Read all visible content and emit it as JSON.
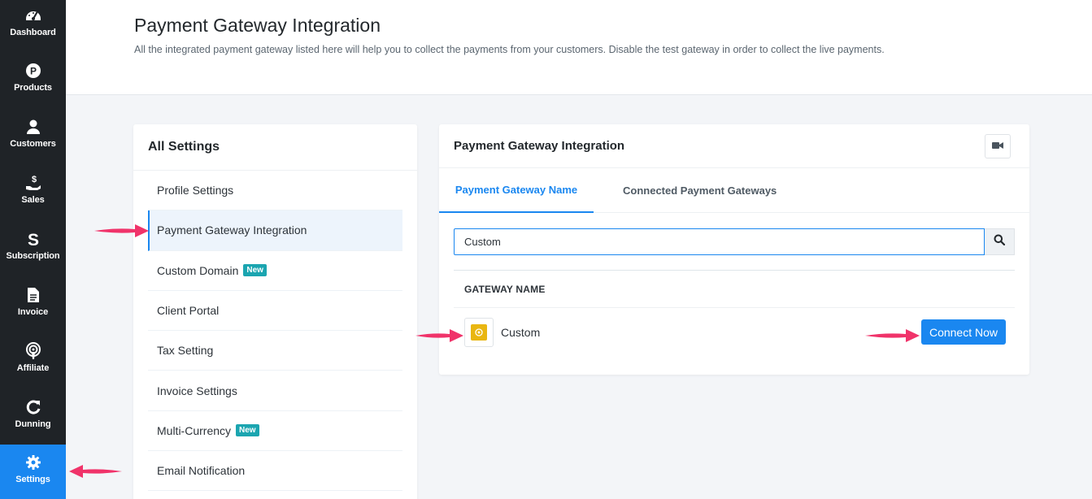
{
  "sidebar": {
    "items": [
      {
        "label": "Dashboard",
        "icon": "dashboard-icon"
      },
      {
        "label": "Products",
        "icon": "products-icon"
      },
      {
        "label": "Customers",
        "icon": "user-icon"
      },
      {
        "label": "Sales",
        "icon": "sales-icon"
      },
      {
        "label": "Subscription",
        "icon": "subscription-icon"
      },
      {
        "label": "Invoice",
        "icon": "invoice-icon"
      },
      {
        "label": "Affiliate",
        "icon": "affiliate-icon"
      },
      {
        "label": "Dunning",
        "icon": "refresh-icon"
      },
      {
        "label": "Settings",
        "icon": "gear-icon",
        "active": true
      }
    ]
  },
  "header": {
    "title": "Payment Gateway Integration",
    "description": "All the integrated payment gateway listed here will help you to collect the payments from your customers. Disable the test gateway in order to collect the live payments."
  },
  "settings": {
    "title": "All Settings",
    "items": [
      {
        "label": "Profile Settings"
      },
      {
        "label": "Payment Gateway Integration",
        "active": true
      },
      {
        "label": "Custom Domain",
        "badge": "New"
      },
      {
        "label": "Client Portal"
      },
      {
        "label": "Tax Setting"
      },
      {
        "label": "Invoice Settings"
      },
      {
        "label": "Multi-Currency",
        "badge": "New"
      },
      {
        "label": "Email Notification"
      }
    ]
  },
  "main": {
    "title": "Payment Gateway Integration",
    "tabs": [
      {
        "label": "Payment Gateway Name",
        "active": true
      },
      {
        "label": "Connected Payment Gateways"
      }
    ],
    "search": {
      "value": "Custom"
    },
    "table": {
      "header": "GATEWAY NAME",
      "rows": [
        {
          "name": "Custom",
          "action": "Connect Now"
        }
      ]
    }
  },
  "colors": {
    "accent": "#1a87f0",
    "sidebar_bg": "#1f2327",
    "badge": "#1ba5b0",
    "arrow": "#f0336a",
    "gateway_logo": "#e9b611"
  }
}
